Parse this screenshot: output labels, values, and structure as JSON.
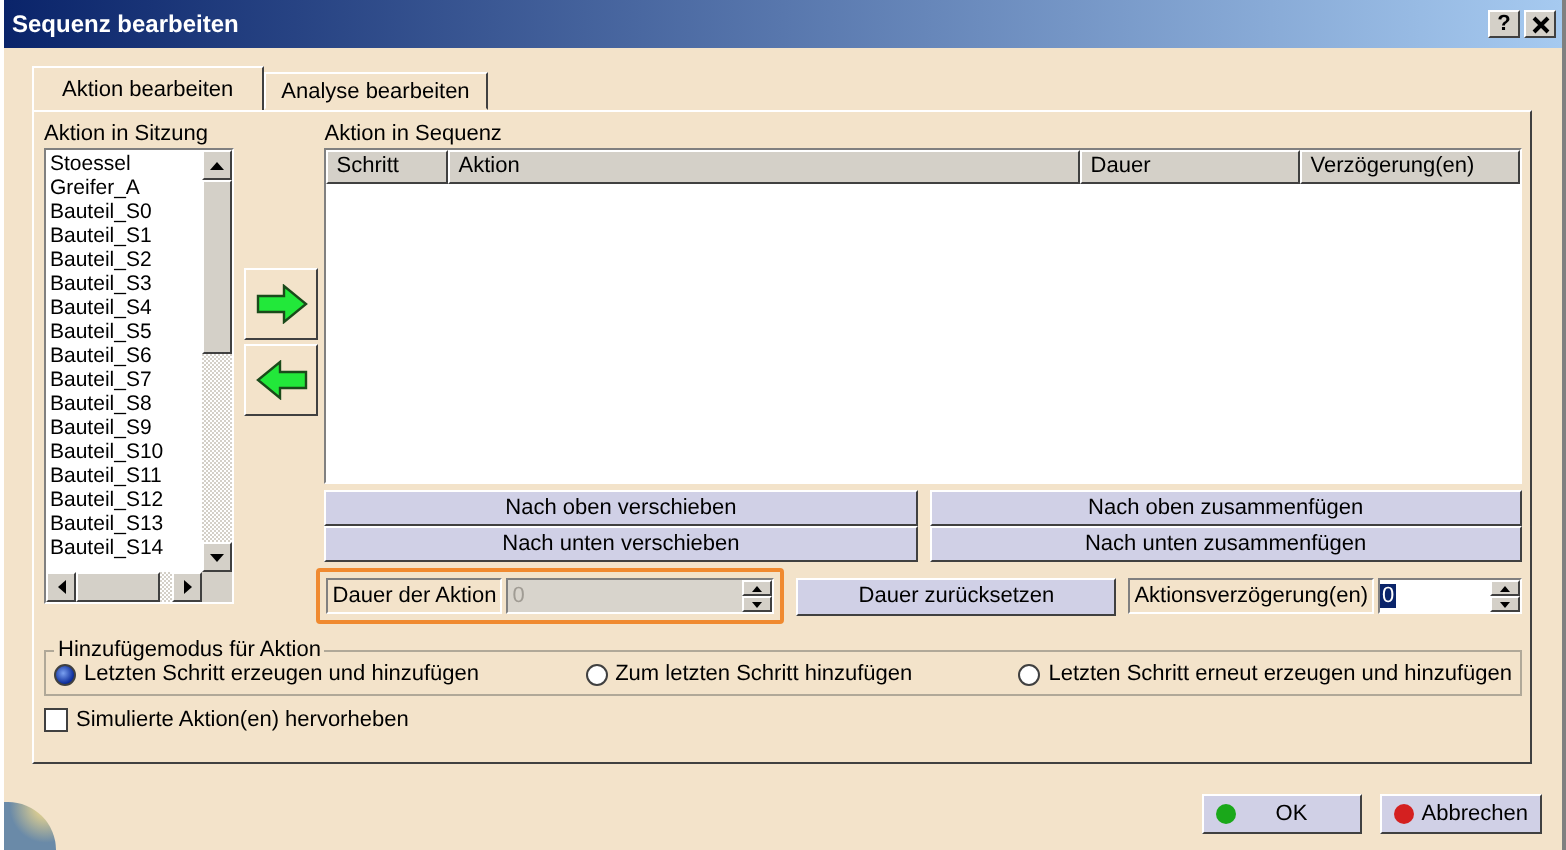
{
  "window": {
    "title": "Sequenz bearbeiten",
    "help_button": "?"
  },
  "tabs": [
    {
      "label": "Aktion bearbeiten",
      "selected": true
    },
    {
      "label": "Analyse bearbeiten",
      "selected": false
    }
  ],
  "session_actions": {
    "label": "Aktion in Sitzung",
    "items": [
      "Stoessel",
      "Greifer_A",
      "Bauteil_S0",
      "Bauteil_S1",
      "Bauteil_S2",
      "Bauteil_S3",
      "Bauteil_S4",
      "Bauteil_S5",
      "Bauteil_S6",
      "Bauteil_S7",
      "Bauteil_S8",
      "Bauteil_S9",
      "Bauteil_S10",
      "Bauteil_S11",
      "Bauteil_S12",
      "Bauteil_S13",
      "Bauteil_S14"
    ]
  },
  "sequence": {
    "label": "Aktion in Sequenz",
    "columns": [
      "Schritt",
      "Aktion",
      "Dauer",
      "Verzögerung(en)"
    ]
  },
  "move_buttons": [
    "Nach oben verschieben",
    "Nach oben zusammenfügen",
    "Nach unten verschieben",
    "Nach unten zusammenfügen"
  ],
  "duration": {
    "label": "Dauer der Aktion",
    "value": "0",
    "disabled": true,
    "highlighted": true
  },
  "reset_button": "Dauer zurücksetzen",
  "delay": {
    "label": "Aktionsverzögerung(en)",
    "value": "0"
  },
  "add_mode": {
    "label": "Hinzufügemodus für Aktion",
    "options": [
      {
        "label": "Letzten Schritt erzeugen und hinzufügen",
        "selected": true
      },
      {
        "label": "Zum letzten Schritt hinzufügen",
        "selected": false
      },
      {
        "label": "Letzten Schritt erneut erzeugen und hinzufügen",
        "selected": false
      }
    ]
  },
  "highlight": {
    "label": "Simulierte Aktion(en) hervorheben",
    "checked": false
  },
  "buttons": [
    {
      "label": "OK",
      "kind": "ok"
    },
    {
      "label": "Abbrechen",
      "kind": "cancel"
    }
  ]
}
